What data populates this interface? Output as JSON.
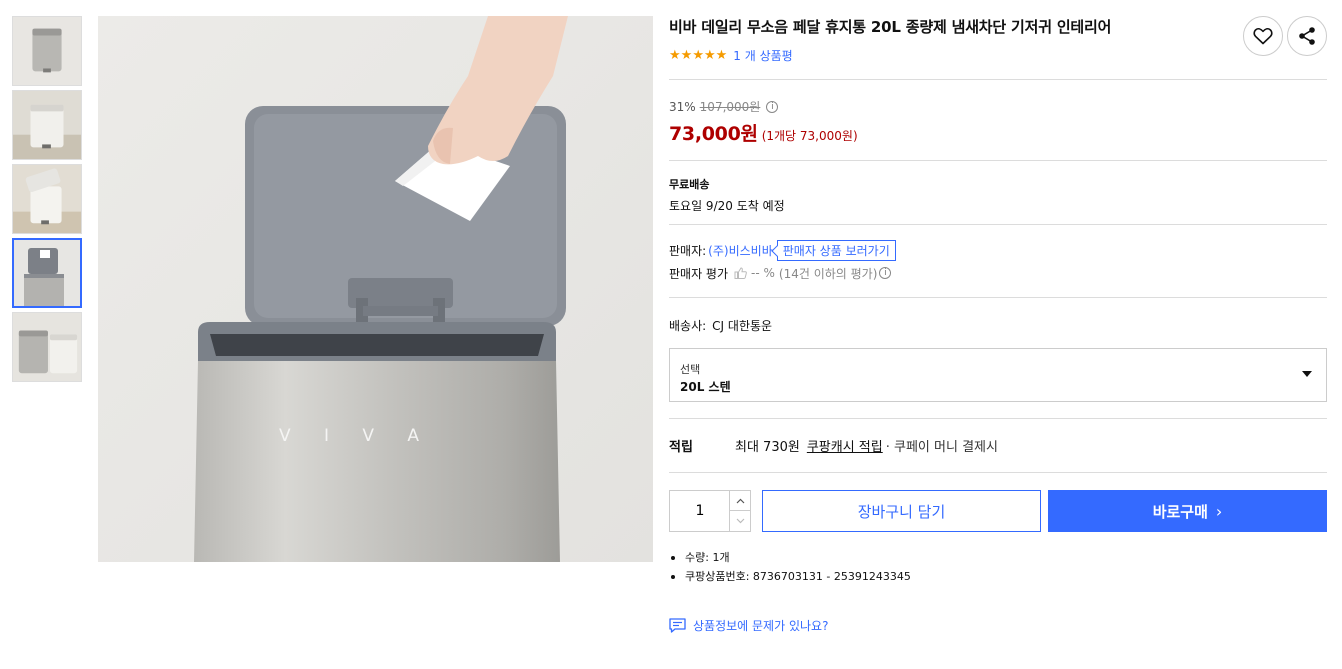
{
  "product": {
    "title": "비바 데일리 무소음 페달 휴지통 20L 종량제 냄새차단 기저귀 인테리어",
    "rating_stars": 5,
    "review_count_text": "1 개 상품평"
  },
  "price": {
    "discount_rate": "31%",
    "original_price": "107,000원",
    "info_icon": "i",
    "sale_price": "73,000원",
    "unit_price": "(1개당 73,000원)"
  },
  "shipping": {
    "label": "무료배송",
    "arrival": "토요일 9/20 도착 예정"
  },
  "seller": {
    "label": "판매자:",
    "name": "(주)비스비바",
    "products_link": "판매자 상품 보러가기",
    "rating_label": "판매자 평가",
    "rating_value": "-- %",
    "rating_note": "(14건 이하의 평가)",
    "info_icon": "i"
  },
  "courier": {
    "label": "배송사:",
    "name": "CJ 대한통운"
  },
  "option": {
    "label": "선택",
    "value": "20L 스텐"
  },
  "reward": {
    "label": "적립",
    "prefix": "최대 730원",
    "link": "쿠팡캐시 적립",
    "suffix": "· 쿠페이 머니 결제시"
  },
  "purchase": {
    "quantity": "1",
    "cart_label": "장바구니 담기",
    "buy_label": "바로구매",
    "buy_chevron": "›"
  },
  "meta": [
    "수량: 1개",
    "쿠팡상품번호: 8736703131 - 25391243345"
  ],
  "report_link": "상품정보에 문제가 있나요?",
  "icons": {
    "wishlist": "heart-icon",
    "share": "share-icon",
    "star": "star-icon",
    "thumb": "thumbs-up-icon",
    "report": "chat-icon"
  },
  "colors": {
    "accent": "#346aff",
    "price": "#ae0000",
    "star": "#f59b00"
  },
  "gallery": {
    "thumbnail_count": 5,
    "active_index": 3,
    "main_image_text": "V I V A"
  }
}
